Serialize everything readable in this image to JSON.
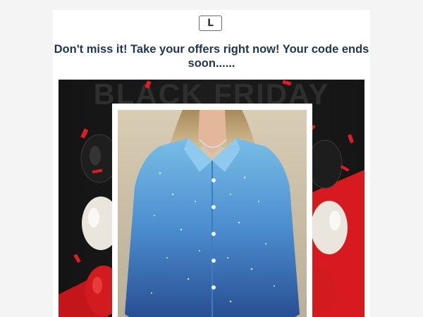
{
  "email": {
    "logo": {
      "letter": "L",
      "icon": "brand-logo-icon"
    },
    "headline": "Don't miss it! Take your offers right now! Your code ends soon......",
    "banner": {
      "background_text": "BLACK FRIDAY",
      "colors": {
        "background": "#161616",
        "accent_red": "#d71a1f",
        "white_balloon": "#eeeae2",
        "sweater_top": "#6fb4e0",
        "sweater_bottom": "#274d92"
      }
    }
  }
}
